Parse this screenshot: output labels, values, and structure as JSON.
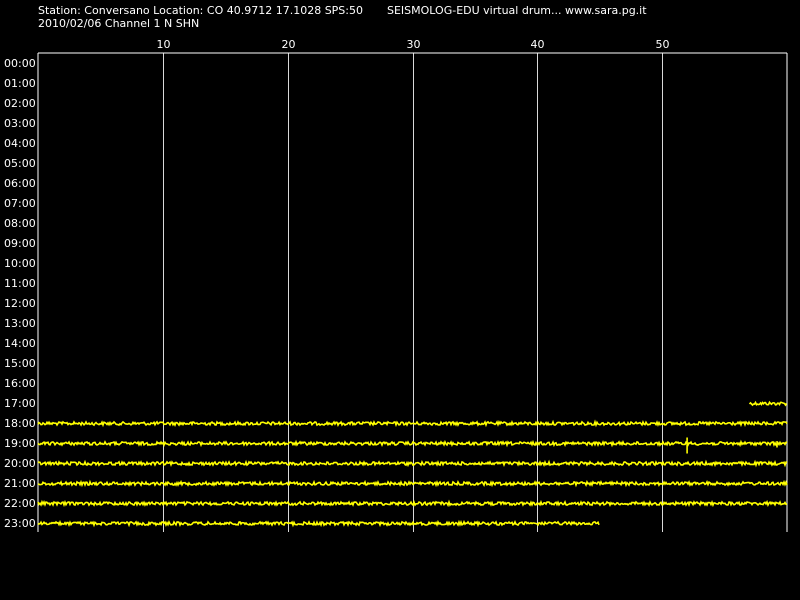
{
  "header": {
    "station_line": "Station: Conversano Location: CO 40.9712 17.1028 SPS:50",
    "app_line": "SEISMOLOG-EDU virtual drum... www.sara.pg.it",
    "date_channel_line": "2010/02/06  Channel 1 N SHN"
  },
  "colors": {
    "background": "#000000",
    "trace": "#ffff00",
    "grid": "#ffffff",
    "text": "#ffffff"
  },
  "chart_data": {
    "type": "line",
    "title": "",
    "x_ticks": [
      10,
      20,
      30,
      40,
      50
    ],
    "xlim": [
      0,
      60
    ],
    "y_labels": [
      "00:00",
      "01:00",
      "02:00",
      "03:00",
      "04:00",
      "05:00",
      "06:00",
      "07:00",
      "08:00",
      "09:00",
      "10:00",
      "11:00",
      "12:00",
      "13:00",
      "14:00",
      "15:00",
      "16:00",
      "17:00",
      "18:00",
      "19:00",
      "20:00",
      "21:00",
      "22:00",
      "23:00"
    ],
    "grid": true,
    "series": [
      {
        "hour": "17:00",
        "start_minute": 57.0,
        "end_minute": 60.0,
        "spikes": []
      },
      {
        "hour": "18:00",
        "start_minute": 0.0,
        "end_minute": 60.0,
        "spikes": []
      },
      {
        "hour": "19:00",
        "start_minute": 0.0,
        "end_minute": 60.0,
        "spikes": [
          {
            "minute": 52.0,
            "amplitude": 10
          },
          {
            "minute": 59.2,
            "amplitude": 4
          }
        ]
      },
      {
        "hour": "20:00",
        "start_minute": 0.0,
        "end_minute": 60.0,
        "spikes": []
      },
      {
        "hour": "21:00",
        "start_minute": 0.0,
        "end_minute": 60.0,
        "spikes": []
      },
      {
        "hour": "22:00",
        "start_minute": 0.0,
        "end_minute": 60.0,
        "spikes": []
      },
      {
        "hour": "23:00",
        "start_minute": 0.0,
        "end_minute": 45.0,
        "spikes": []
      }
    ]
  }
}
